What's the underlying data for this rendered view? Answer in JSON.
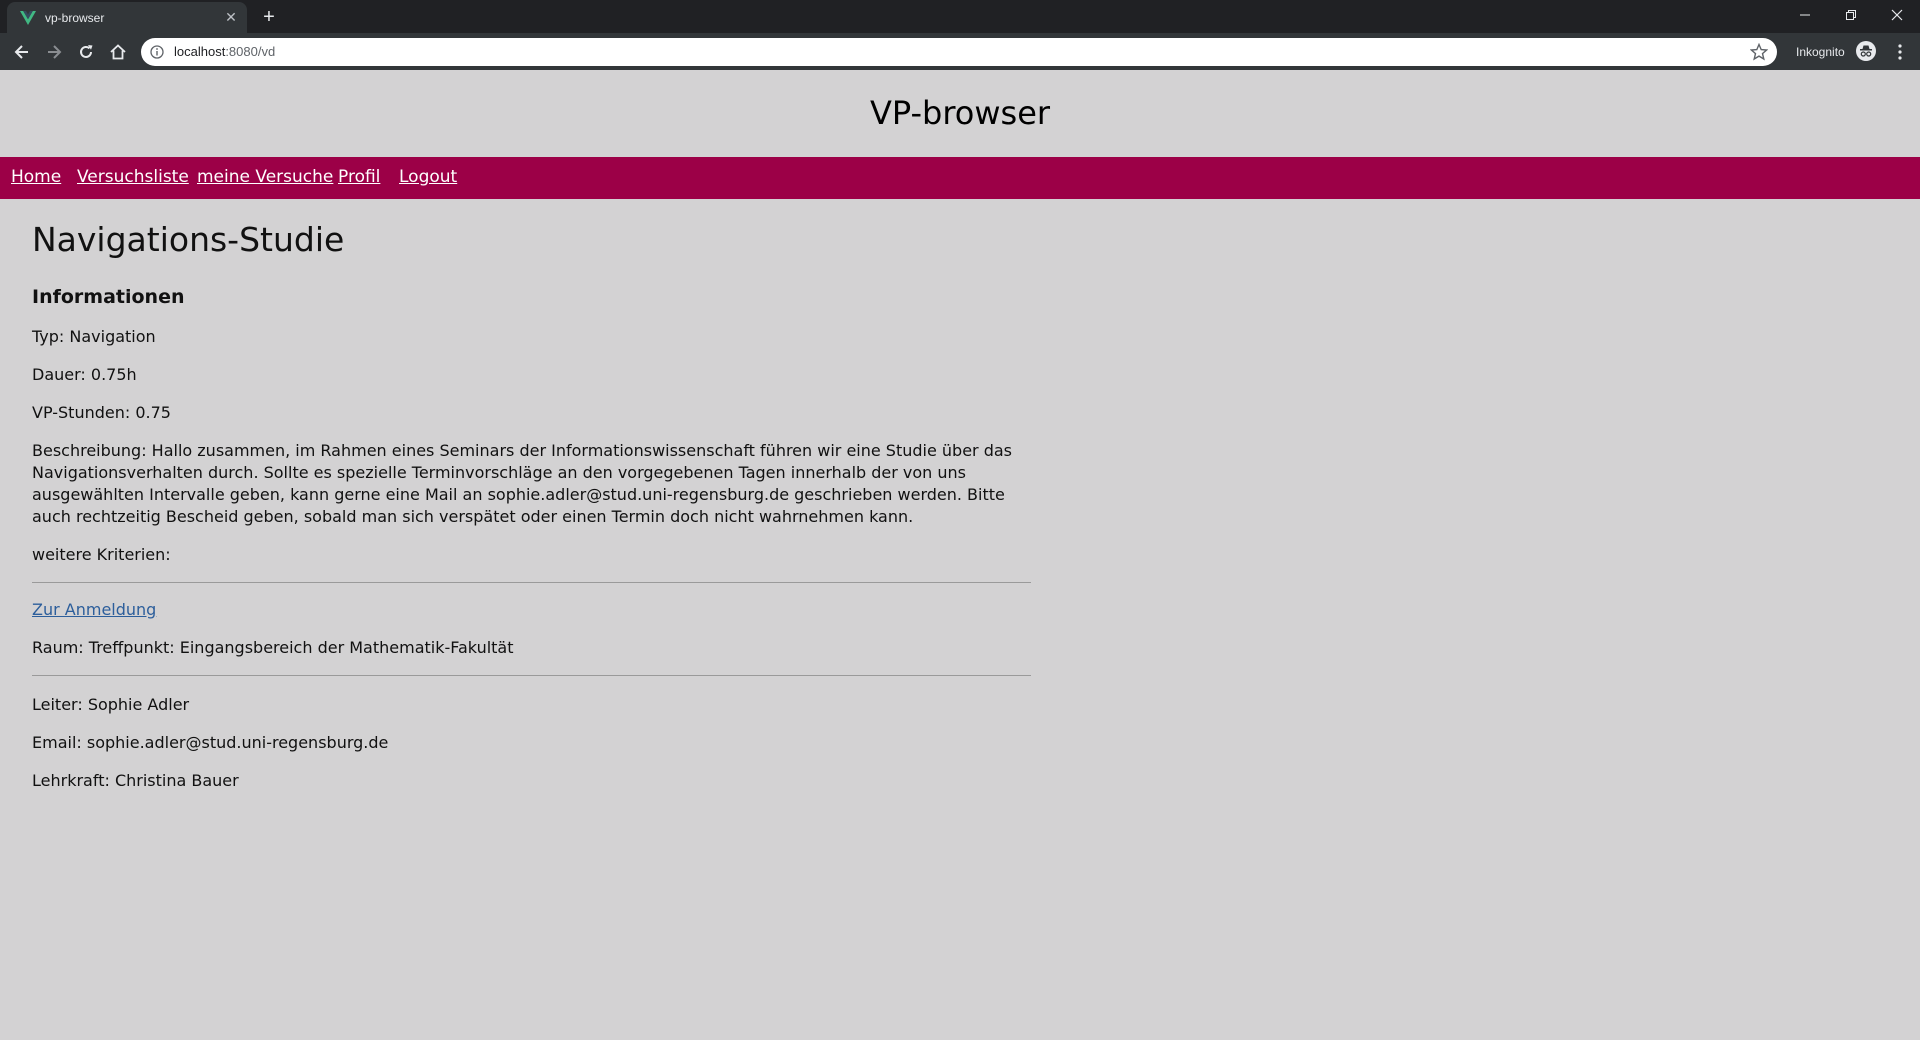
{
  "browser": {
    "tab_title": "vp-browser",
    "url_host": "localhost",
    "url_rest": ":8080/vd",
    "incognito_label": "Inkognito"
  },
  "site": {
    "title": "VP-browser",
    "nav": [
      "Home",
      "Versuchsliste",
      "meine Versuche",
      "Profil",
      "Logout"
    ]
  },
  "study": {
    "title": "Navigations-Studie",
    "section_heading": "Informationen",
    "typ": "Typ: Navigation",
    "dauer": "Dauer: 0.75h",
    "vp_stunden": "VP-Stunden: 0.75",
    "beschreibung": "Beschreibung: Hallo zusammen, im Rahmen eines Seminars der Informationswissenschaft führen wir eine Studie über das Navigationsverhalten durch. Sollte es spezielle Terminvorschläge an den vorgegebenen Tagen innerhalb der von uns ausgewählten Intervalle geben, kann gerne eine Mail an sophie.adler@stud.uni-regensburg.de geschrieben werden. Bitte auch rechtzeitig Bescheid geben, sobald man sich verspätet oder einen Termin doch nicht wahrnehmen kann.",
    "kriterien": "weitere Kriterien:",
    "anmeldung_link": "Zur Anmeldung",
    "raum": "Raum: Treffpunkt: Eingangsbereich der Mathematik-Fakultät",
    "leiter": "Leiter: Sophie Adler",
    "email": "Email: sophie.adler@stud.uni-regensburg.de",
    "lehrkraft": "Lehrkraft: Christina Bauer"
  },
  "colors": {
    "page_bg": "#d3d2d3",
    "navbar_bg": "#9c0047",
    "link": "#2c5e9b",
    "favicon_green": "#41b883"
  },
  "icons": {
    "favicon": "vue-logo-icon",
    "tab_close": "close-icon",
    "new_tab": "plus-icon",
    "back": "arrow-left-icon",
    "forward": "arrow-right-icon",
    "reload": "reload-icon",
    "home": "home-icon",
    "site_info": "info-icon",
    "bookmark": "star-icon",
    "incognito": "incognito-icon",
    "menu": "kebab-menu-icon",
    "minimize": "minimize-icon",
    "restore": "restore-icon",
    "close_window": "close-window-icon"
  }
}
